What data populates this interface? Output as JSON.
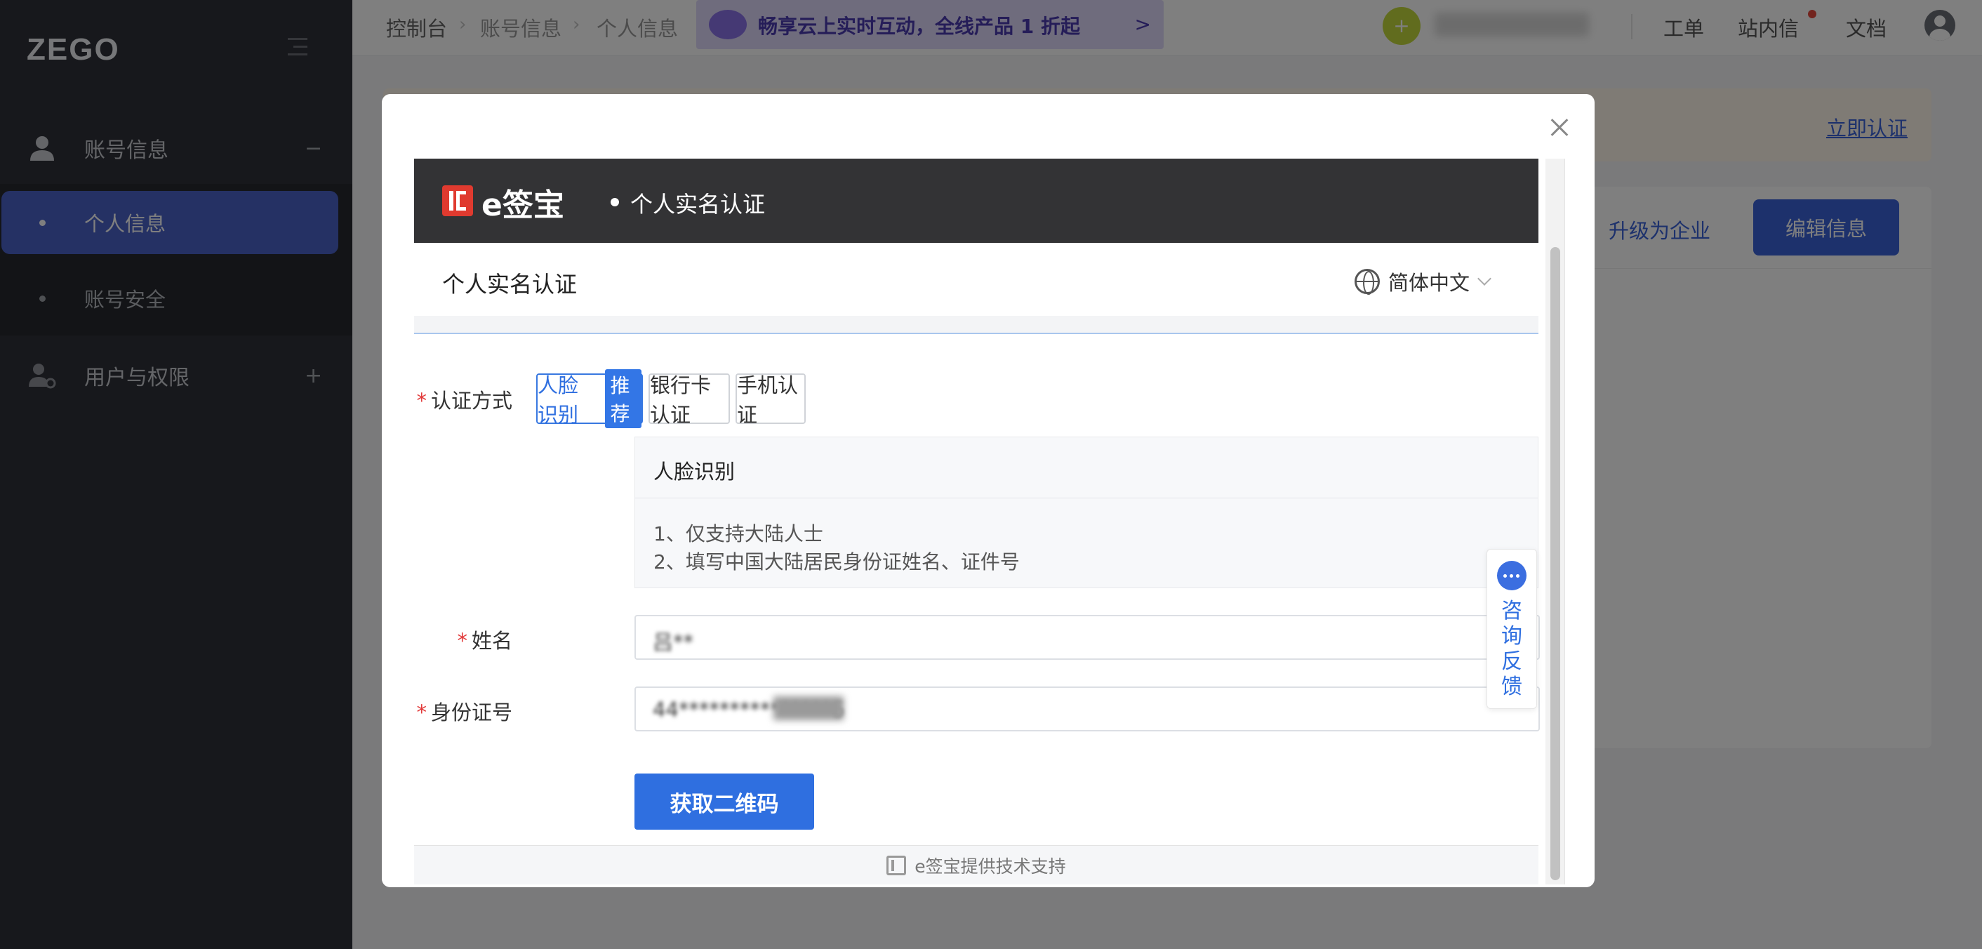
{
  "sidebar": {
    "logo": "ZEGO",
    "groups": [
      {
        "label": "账号信息",
        "toggle": "−",
        "icon": "user-icon"
      },
      {
        "label": "用户与权限",
        "toggle": "+",
        "icon": "users-permission-icon"
      }
    ],
    "sub_items": [
      {
        "label": "个人信息",
        "active": true
      },
      {
        "label": "账号安全",
        "active": false
      }
    ]
  },
  "topbar": {
    "breadcrumb": [
      "控制台",
      "账号信息",
      "个人信息"
    ],
    "promo_text": "畅享云上实时互动，全线产品 1 折起",
    "promo_arrow": ">",
    "avatar_text": "+",
    "links": {
      "ticket": "工单",
      "messages": "站内信",
      "docs": "文档"
    }
  },
  "background": {
    "verify_link": "立即认证",
    "upgrade_link": "升级为企业",
    "edit_button": "编辑信息"
  },
  "modal": {
    "brand": "e签宝",
    "header_title": "个人实名认证",
    "subheader_title": "个人实名认证",
    "language": "简体中文",
    "auth_method_label": "认证方式",
    "methods": [
      {
        "label": "人脸识别",
        "badge": "推荐",
        "selected": true
      },
      {
        "label": "银行卡认证",
        "selected": false
      },
      {
        "label": "手机认证",
        "selected": false
      }
    ],
    "info": {
      "title": "人脸识别",
      "line1": "1、仅支持大陆人士",
      "line2": "2、填写中国大陆居民身份证姓名、证件号"
    },
    "name_label": "姓名",
    "name_value": "吕**",
    "id_label": "身份证号",
    "id_value": "44***************6",
    "submit_button": "获取二维码",
    "footer_text": "e签宝提供技术支持",
    "feedback_text": "咨询反馈"
  },
  "colors": {
    "sidebar_bg": "#2f3138",
    "active_item": "#4b62c9",
    "primary_blue": "#2f6fe0",
    "required_red": "#e23b3b"
  }
}
